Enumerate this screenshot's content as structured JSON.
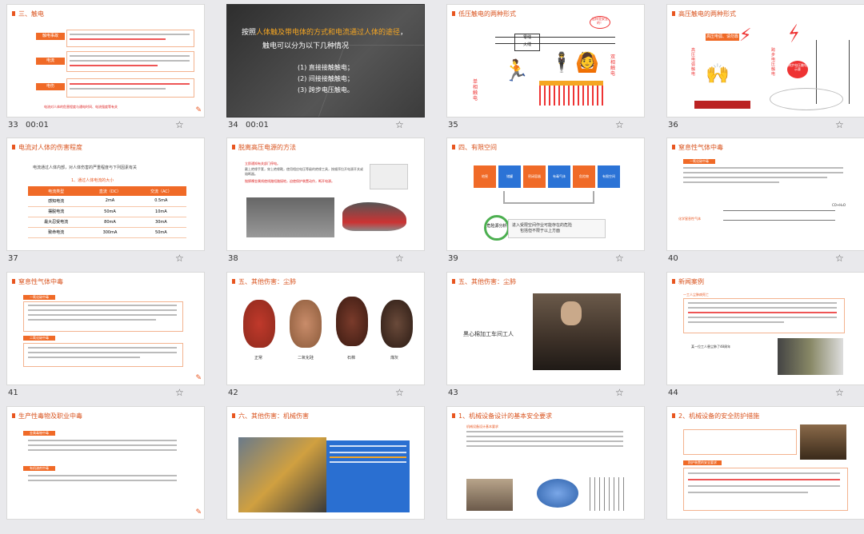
{
  "slides": [
    {
      "num": "33",
      "time": "00:01",
      "title": "三、触电",
      "labels": [
        "触电事故",
        "电流",
        "电伤"
      ],
      "footer": "电流对人体的危害程度与通电时间、电流强度等有关"
    },
    {
      "num": "34",
      "time": "00:01",
      "title_plain": "按照",
      "title_hl": "人体触及带电体的方式和电流通过人体的途径",
      "title_end": "，",
      "line2": "触电可以分为以下几种情况",
      "items": [
        "(1) 直接接触触电；",
        "(2) 间接接触触电；",
        "(3) 跨步电压触电。"
      ]
    },
    {
      "num": "35",
      "title": "低压触电的两种形式",
      "callout": "这样是安全的！",
      "wire_label": "零线\n火线",
      "left_label": "单相触电",
      "right_label": "双相触电"
    },
    {
      "num": "36",
      "title": "高压触电的两种形式",
      "labels": [
        "高压电弧、请勿靠近",
        "高压电弧触电",
        "跨步电压触电"
      ],
      "callout": "跨步电压触电示意"
    },
    {
      "num": "37",
      "title": "电流对人体的伤害程度",
      "intro": "电流通过人体内部，对人体伤害的严重程度与下列因素有关",
      "subtitle": "1、通过人体电流的大小",
      "table": {
        "headers": [
          "电流类型",
          "直流（DC）",
          "交流（AC）"
        ],
        "rows": [
          [
            "感知电流",
            "2mA",
            "0.5mA"
          ],
          [
            "摆脱电流",
            "50mA",
            "10mA"
          ],
          [
            "最大忍受电流",
            "80mA",
            "30mA"
          ],
          [
            "致命电流",
            "300mA",
            "50mA"
          ]
        ]
      }
    },
    {
      "num": "38",
      "title": "脱离高压电源的方法",
      "bullets": [
        "立即通知有关部门停电。",
        "戴上绝缘手套，穿上绝缘靴，使用相应电压等级的绝缘工具，按顺序拉开电源开关或熔断器。",
        "抛掷裸金属线使线路短路接地，迫使保护装置动作，断开电源。"
      ]
    },
    {
      "num": "39",
      "title": "四、有限空间",
      "boxes": [
        "地窖",
        "储罐",
        "密闭容器",
        "有毒气体",
        "危险物",
        "有限空间"
      ],
      "circle": "危险源分析",
      "banner": "进入受限空间作业可能存在的危险",
      "banner2": "包括但不限于以上方面"
    },
    {
      "num": "40",
      "title": "窒息性气体中毒",
      "subhead": "一氧化碳中毒",
      "chem_label": "化学窒息性气体",
      "equation": "CO+H₂O"
    },
    {
      "num": "41",
      "title": "窒息性气体中毒",
      "tag1": "一氧化碳中毒",
      "tag2": "二氧化碳中毒"
    },
    {
      "num": "42",
      "title": "五、其他伤害：尘肺",
      "lungs": [
        "正常",
        "二氧化硅",
        "石棉",
        "煤灰"
      ]
    },
    {
      "num": "43",
      "title": "五、其他伤害：尘肺",
      "caption": "黑心棉加工车间工人"
    },
    {
      "num": "44",
      "title": "新闻案例",
      "headline": "一工人尘肺病死亡",
      "photo_caption": "某一位工人患尘肺了48周年"
    },
    {
      "num": "45",
      "title": "生产性毒物及职业中毒",
      "tags": [
        "金属毒物中毒",
        "有机溶剂中毒"
      ]
    },
    {
      "num": "46",
      "title": "六、其他伤害：机械伤害"
    },
    {
      "num": "47",
      "title": "1、机械设备设计的基本安全要求",
      "subhead": "机械设备设计基本要求"
    },
    {
      "num": "48",
      "title": "2、机械设备的安全防护措施",
      "subhead": "防护装置的安全要求"
    }
  ],
  "icons": {
    "star": "star-outline-icon",
    "corner": "pen-icon"
  },
  "colors": {
    "accent": "#e8551f",
    "table_header": "#f06a27",
    "highlight": "#f5a623"
  }
}
